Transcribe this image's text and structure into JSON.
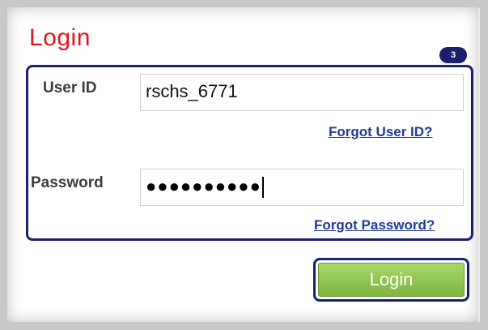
{
  "title": "Login",
  "step_badge": "3",
  "user_id": {
    "label": "User ID",
    "value": "rschs_6771",
    "forgot_link": "Forgot User ID?"
  },
  "password": {
    "label": "Password",
    "masked_value": "●●●●●●●●●●",
    "forgot_link": "Forgot Password?"
  },
  "login_button": "Login",
  "colors": {
    "title": "#e8141a",
    "highlight_border": "#1b1f70",
    "button": "#8cc34a",
    "link": "#1f3b9a"
  }
}
